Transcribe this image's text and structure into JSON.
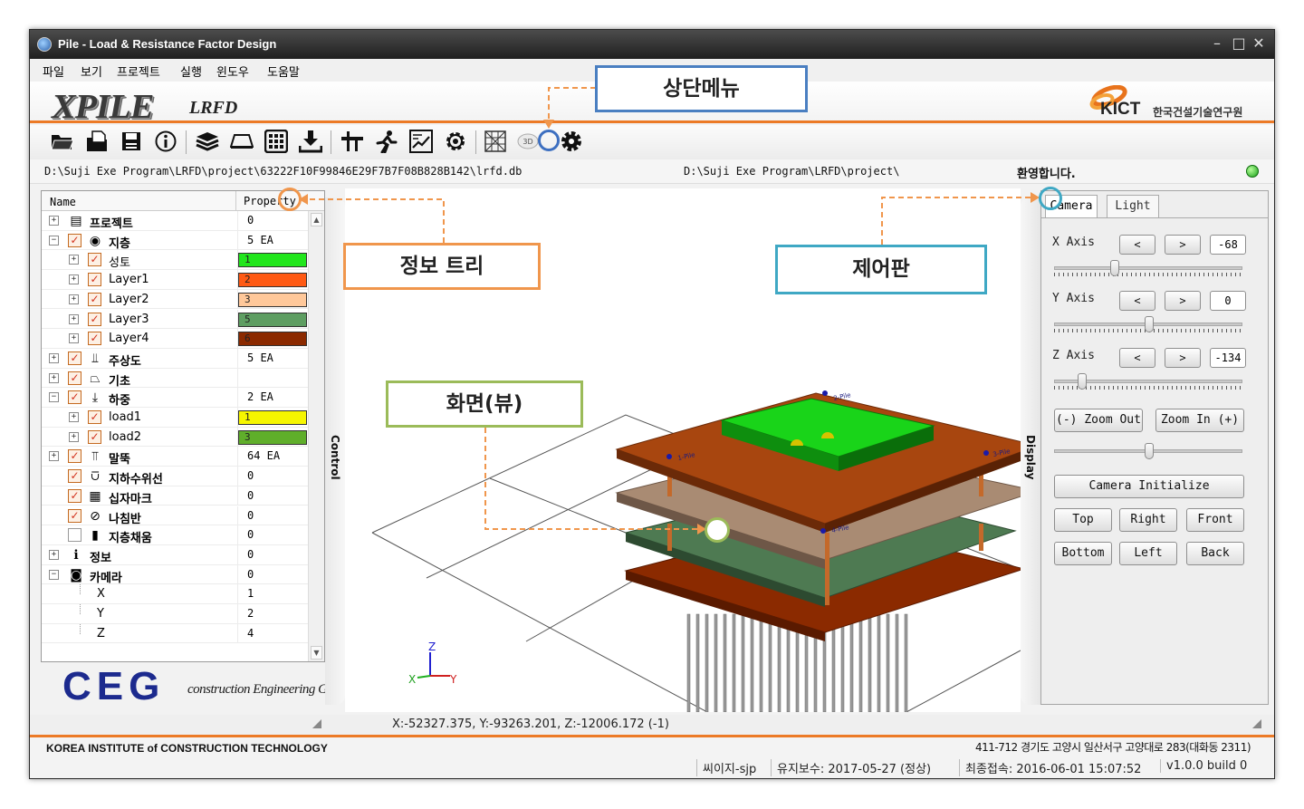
{
  "window": {
    "title": "Pile - Load & Resistance Factor Design"
  },
  "menu": [
    "파일",
    "보기",
    "프로젝트",
    "실행",
    "윈도우",
    "도움말"
  ],
  "banner": {
    "logo": "XPILE",
    "logo_sub": "LRFD",
    "org_logo": "KICT",
    "org_name": "한국건설기술연구원"
  },
  "toolbar": {
    "icons": [
      "open-folder-icon",
      "open-file-icon",
      "save-icon",
      "info-icon",
      "layers-icon",
      "foundation-icon",
      "grid-icon",
      "load-icon",
      "pile-icon",
      "runner-icon",
      "chart-icon",
      "settings-gear-icon",
      "mesh-icon",
      "3d-icon",
      "view-settings-icon"
    ]
  },
  "path": {
    "left": "D:\\Suji Exe Program\\LRFD\\project\\63222F10F99846E29F7B7F08B828B142\\lrfd.db",
    "right": "D:\\Suji Exe Program\\LRFD\\project\\",
    "welcome": "환영합니다."
  },
  "tree": {
    "col_name": "Name",
    "col_prop": "Property",
    "rows": [
      {
        "label": "프로젝트",
        "value": "0"
      },
      {
        "label": "지층",
        "value": "5 EA"
      },
      {
        "label": "성토",
        "value": "1",
        "color": "#21e61c"
      },
      {
        "label": "Layer1",
        "value": "2",
        "color": "#ff5a14"
      },
      {
        "label": "Layer2",
        "value": "3",
        "color": "#ffc89a"
      },
      {
        "label": "Layer3",
        "value": "5",
        "color": "#5e9e62"
      },
      {
        "label": "Layer4",
        "value": "6",
        "color": "#8b2a00"
      },
      {
        "label": "주상도",
        "value": "5 EA"
      },
      {
        "label": "기초",
        "value": ""
      },
      {
        "label": "하중",
        "value": "2 EA"
      },
      {
        "label": "load1",
        "value": "1",
        "color": "#f6f600"
      },
      {
        "label": "load2",
        "value": "3",
        "color": "#5fae2a"
      },
      {
        "label": "말뚝",
        "value": "64 EA"
      },
      {
        "label": "지하수위선",
        "value": "0"
      },
      {
        "label": "십자마크",
        "value": "0"
      },
      {
        "label": "나침반",
        "value": "0"
      },
      {
        "label": "지층채움",
        "value": "0"
      },
      {
        "label": "정보",
        "value": "0"
      },
      {
        "label": "카메라",
        "value": "0"
      },
      {
        "label": "X",
        "value": "1"
      },
      {
        "label": "Y",
        "value": "2"
      },
      {
        "label": "Z",
        "value": "4"
      }
    ]
  },
  "ceg": {
    "logo": "CEG",
    "text": "construction Engineering Group"
  },
  "side_tabs": {
    "left": "Control",
    "right": "Display"
  },
  "viewport": {
    "pile_labels": [
      "1-Pile",
      "2-Pile",
      "3-Pile",
      "4-Pile"
    ],
    "axis_labels": {
      "x": "X",
      "y": "Y",
      "z": "Z"
    }
  },
  "controls": {
    "tabs": [
      "Camera",
      "Light"
    ],
    "x_axis": {
      "label": "X Axis",
      "value": "-68"
    },
    "y_axis": {
      "label": "Y Axis",
      "value": "0"
    },
    "z_axis": {
      "label": "Z Axis",
      "value": "-134"
    },
    "prev": "<",
    "next": ">",
    "zoom_out": "(-) Zoom Out",
    "zoom_in": "Zoom In (+)",
    "camera_init": "Camera Initialize",
    "views": [
      "Top",
      "Right",
      "Front",
      "Bottom",
      "Left",
      "Back"
    ]
  },
  "coords": "X:-52327.375, Y:-93263.201, Z:-12006.172 (-1)",
  "footer": {
    "org": "KOREA INSTITUTE of CONSTRUCTION TECHNOLOGY",
    "address": "411-712 경기도 고양시 일산서구 고양대로 283(대화동 2311)",
    "user": "씨이지-sjp",
    "maintenance": "유지보수: 2017-05-27 (정상)",
    "last_login": "최종접속: 2016-06-01 15:07:52",
    "version": "v1.0.0 build 0"
  },
  "callouts": {
    "top_menu": "상단메뉴",
    "info_tree": "정보 트리",
    "control_panel": "제어판",
    "view": "화면(뷰)"
  },
  "colors": {
    "accent": "#ec7a26",
    "top_menu_border": "#4a7fc1",
    "info_tree_border": "#f0964c",
    "control_panel_border": "#3fa8c4",
    "view_border": "#9bbb59"
  }
}
